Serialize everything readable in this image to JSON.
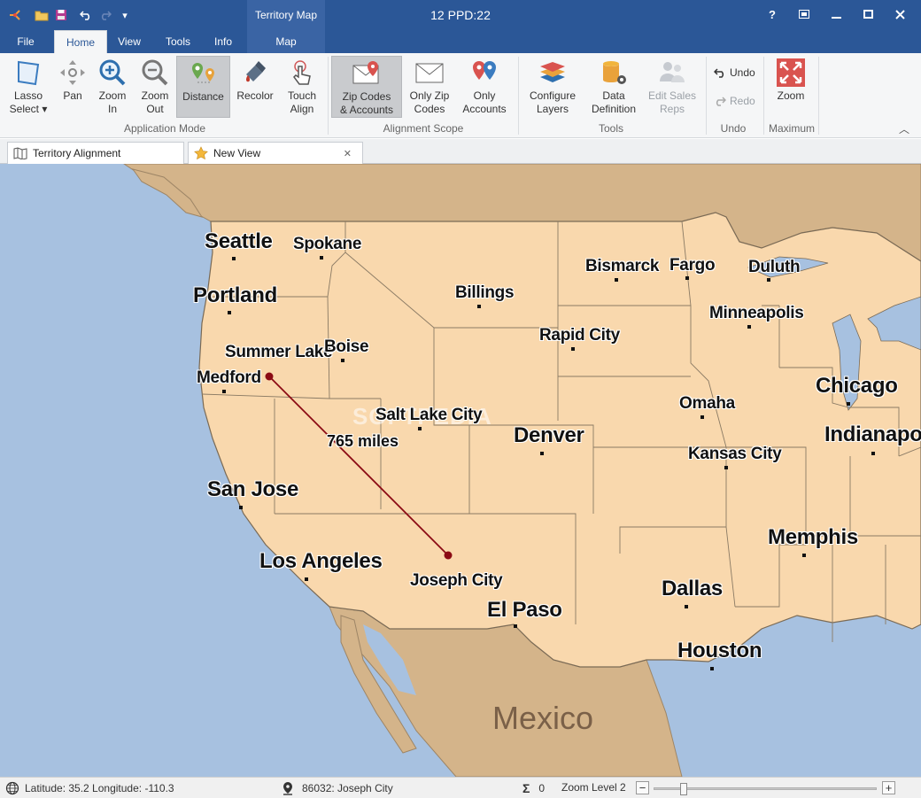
{
  "window": {
    "title": "12 PPD:22",
    "context_group": "Territory Map",
    "controls": {
      "help": "?",
      "restore": "⧉",
      "minimize": "—",
      "maximize": "☐",
      "close": "✕"
    }
  },
  "ribbon_tabs": [
    {
      "label": "File"
    },
    {
      "label": "Home"
    },
    {
      "label": "View"
    },
    {
      "label": "Tools"
    },
    {
      "label": "Info"
    },
    {
      "label": "Map"
    }
  ],
  "ribbon": {
    "application_mode": {
      "label": "Application Mode",
      "buttons": [
        {
          "line1": "Lasso",
          "line2": "Select ▾",
          "icon": "lasso-icon"
        },
        {
          "line1": "Pan",
          "line2": "",
          "icon": "pan-icon"
        },
        {
          "line1": "Zoom",
          "line2": "In",
          "icon": "zoom-in-icon"
        },
        {
          "line1": "Zoom",
          "line2": "Out",
          "icon": "zoom-out-icon"
        },
        {
          "line1": "Distance",
          "line2": "",
          "icon": "distance-icon"
        },
        {
          "line1": "Recolor",
          "line2": "",
          "icon": "recolor-icon"
        },
        {
          "line1": "Touch",
          "line2": "Align",
          "icon": "touch-icon"
        }
      ]
    },
    "alignment_scope": {
      "label": "Alignment Scope",
      "buttons": [
        {
          "line1": "Zip Codes",
          "line2": "& Accounts",
          "icon": "zip-accounts-icon"
        },
        {
          "line1": "Only Zip",
          "line2": "Codes",
          "icon": "envelope-icon"
        },
        {
          "line1": "Only",
          "line2": "Accounts",
          "icon": "map-pins-icon"
        }
      ]
    },
    "tools": {
      "label": "Tools",
      "buttons": [
        {
          "line1": "Configure",
          "line2": "Layers",
          "icon": "layers-icon"
        },
        {
          "line1": "Data",
          "line2": "Definition",
          "icon": "database-icon"
        },
        {
          "line1": "Edit Sales",
          "line2": "Reps",
          "icon": "sales-reps-icon"
        }
      ]
    },
    "undo": {
      "label": "Undo",
      "undo": "Undo",
      "redo": "Redo"
    },
    "maximum": {
      "label": "Maximum",
      "zoom": "Zoom"
    }
  },
  "doc_tabs": [
    {
      "label": "Territory Alignment"
    },
    {
      "label": "New View",
      "close": "✕"
    }
  ],
  "map": {
    "cities": [
      {
        "name": "Seattle"
      },
      {
        "name": "Spokane"
      },
      {
        "name": "Portland"
      },
      {
        "name": "Billings"
      },
      {
        "name": "Bismarck"
      },
      {
        "name": "Fargo"
      },
      {
        "name": "Duluth"
      },
      {
        "name": "Minneapolis"
      },
      {
        "name": "Rapid City"
      },
      {
        "name": "Summer Lake"
      },
      {
        "name": "Boise"
      },
      {
        "name": "Medford"
      },
      {
        "name": "Chicago"
      },
      {
        "name": "Omaha"
      },
      {
        "name": "Salt Lake City"
      },
      {
        "name": "Denver"
      },
      {
        "name": "Indianapolis"
      },
      {
        "name": "Kansas City"
      },
      {
        "name": "San Jose"
      },
      {
        "name": "Memphis"
      },
      {
        "name": "Los Angeles"
      },
      {
        "name": "Joseph City"
      },
      {
        "name": "Dallas"
      },
      {
        "name": "El Paso"
      },
      {
        "name": "Houston"
      }
    ],
    "country_label": "Mexico",
    "distance": "765 miles",
    "watermark": "SOFTPEDIA"
  },
  "status": {
    "latlon": "Latitude: 35.2 Longitude: -110.3",
    "location": "86032: Joseph City",
    "sum_symbol": "Σ",
    "count": "0",
    "zoom_level": "Zoom Level 2",
    "zoom_out": "−",
    "zoom_in": "+",
    "zoom_fraction": 0.12
  }
}
